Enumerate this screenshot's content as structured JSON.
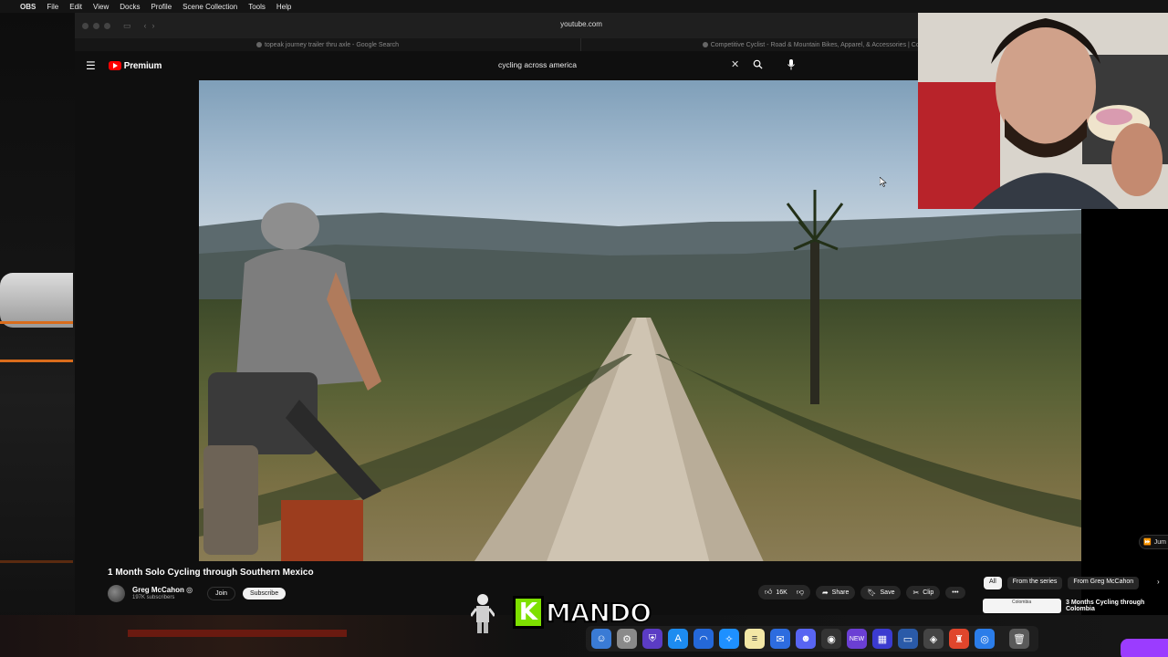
{
  "menubar": {
    "app": "OBS",
    "items": [
      "File",
      "Edit",
      "View",
      "Docks",
      "Profile",
      "Scene Collection",
      "Tools",
      "Help"
    ]
  },
  "browser": {
    "url": "youtube.com",
    "tabs": [
      "topeak journey trailer thru axle - Google Search",
      "Competitive Cyclist - Road & Mountain Bikes, Apparel, & Accessories | Competitive Cyclist"
    ]
  },
  "youtube": {
    "logo_text": "Premium",
    "search_query": "cycling across america",
    "video_title": "1 Month Solo Cycling through Southern Mexico",
    "channel": {
      "name": "Greg McCahon",
      "subscribers": "197K subscribers",
      "join_label": "Join",
      "subscribe_label": "Subscribe"
    },
    "actions": {
      "likes": "16K",
      "share": "Share",
      "save": "Save",
      "clip": "Clip",
      "more": "•••"
    },
    "chips": [
      "All",
      "From the series",
      "From Greg McCahon"
    ],
    "jump_label": "Jum",
    "recommended": {
      "thumb_tag": "Colombia",
      "title": "3 Months Cycling through Colombia"
    }
  },
  "overlay": {
    "logo_letter": "K",
    "logo_text": "MANDO"
  },
  "colors": {
    "yt_red": "#ff0000",
    "accent_green": "#7ee000",
    "twitch_purple": "#9b3cff"
  }
}
